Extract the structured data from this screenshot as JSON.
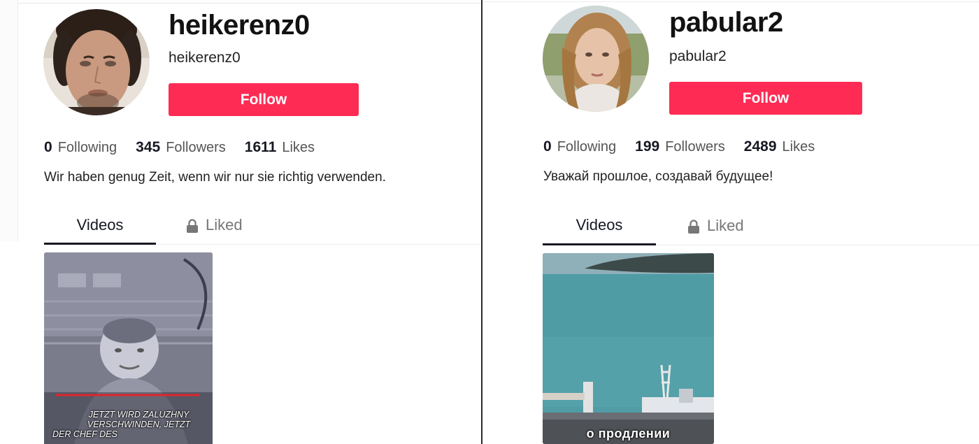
{
  "profiles": [
    {
      "username": "heikerenz0",
      "handle": "heikerenz0",
      "follow_label": "Follow",
      "following_count": "0",
      "following_label": "Following",
      "followers_count": "345",
      "followers_label": "Followers",
      "likes_count": "1611",
      "likes_label": "Likes",
      "bio": "Wir haben genug Zeit, wenn wir nur sie richtig verwenden.",
      "tabs": {
        "videos": "Videos",
        "liked": "Liked"
      },
      "video_caption_lines": [
        "JETZT WIRD ZALUZHNY",
        "VERSCHWINDEN, JETZT",
        "DER CHEF DES"
      ]
    },
    {
      "username": "pabular2",
      "handle": "pabular2",
      "follow_label": "Follow",
      "following_count": "0",
      "following_label": "Following",
      "followers_count": "199",
      "followers_label": "Followers",
      "likes_count": "2489",
      "likes_label": "Likes",
      "bio": "Уважай прошлое, создавай будущее!",
      "tabs": {
        "videos": "Videos",
        "liked": "Liked"
      },
      "video_caption_lines": [
        "о продлении"
      ]
    }
  ],
  "colors": {
    "follow_button": "#fe2c55",
    "text_primary": "#161823",
    "text_secondary": "#555555",
    "tab_inactive": "#777777"
  },
  "icons": [
    "lock-icon"
  ]
}
